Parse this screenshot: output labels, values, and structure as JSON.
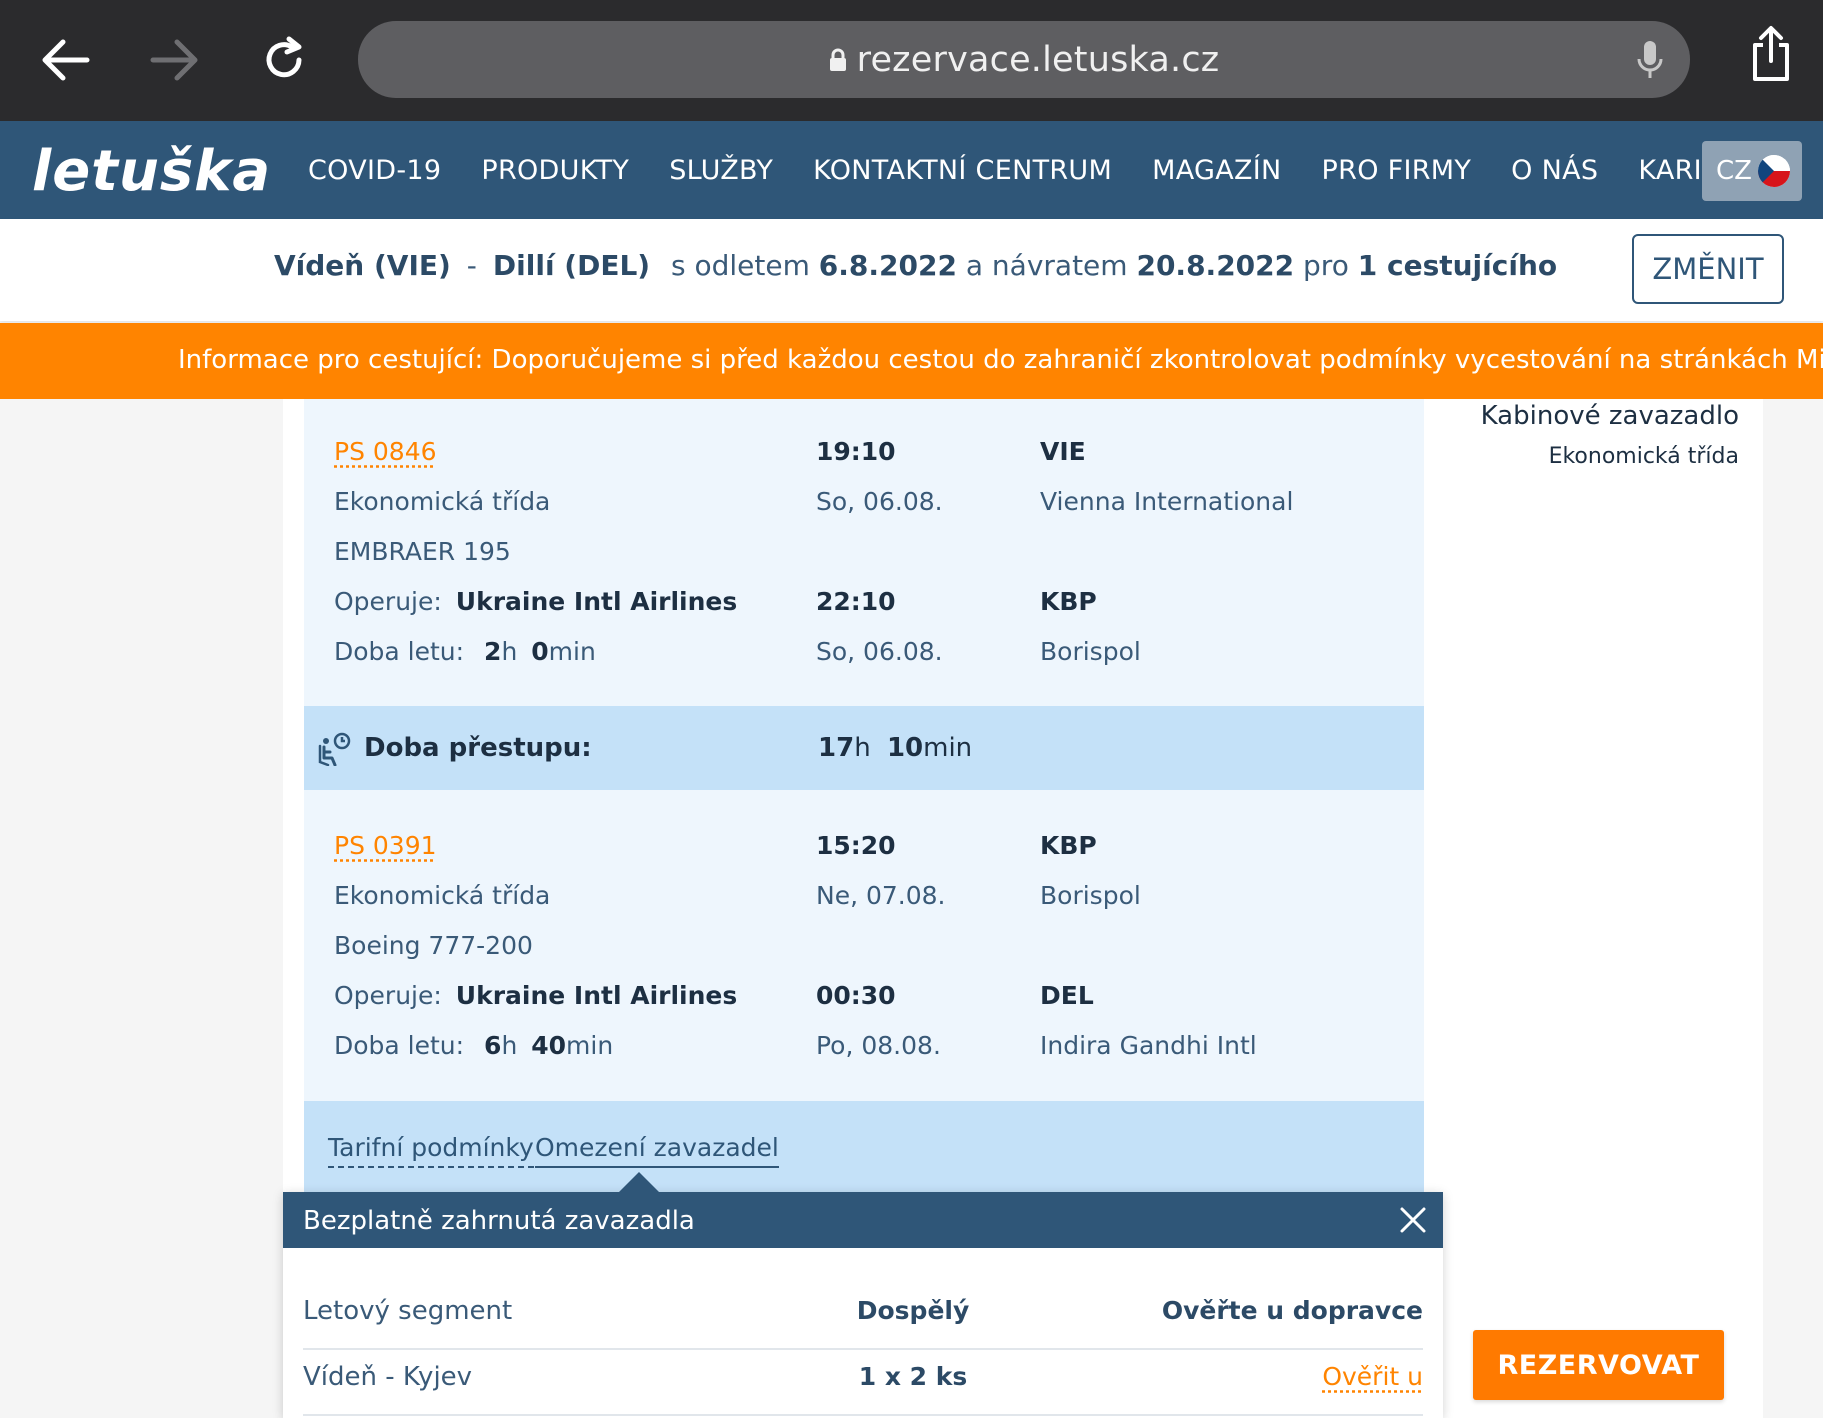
{
  "browser": {
    "url": "rezervace.letuska.cz"
  },
  "site": {
    "logo": "letuška",
    "menu": [
      "COVID-19",
      "PRODUKTY",
      "SLUŽBY",
      "KONTAKTNÍ CENTRUM",
      "MAGAZÍN",
      "PRO FIRMY",
      "O NÁS",
      "KARIÉRA"
    ],
    "language": "CZ"
  },
  "summary": {
    "from": "Vídeň (VIE)",
    "dash": "-",
    "to": "Dillí (DEL)",
    "departure_label": "s odletem",
    "departure_date": "6.8.2022",
    "return_label": "a návratem",
    "return_date": "20.8.2022",
    "for_label": "pro",
    "passengers": "1 cestujícího",
    "change_button": "ZMĚNIT"
  },
  "banner": {
    "text": "Informace pro cestující: Doporučujeme si před každou cestou do zahraničí zkontrolovat podmínky vycestování na stránkách Ministerstva zahra"
  },
  "sidebar": {
    "baggage_title": "Kabinové zavazadlo",
    "baggage_class": "Ekonomická třída"
  },
  "segments": [
    {
      "flight_no": "PS 0846",
      "cabin": "Ekonomická třída",
      "aircraft": "EMBRAER 195",
      "operated_label": "Operuje:",
      "operator": "Ukraine Intl Airlines",
      "duration_label": "Doba letu:",
      "duration_h": "2",
      "duration_m": "0",
      "h_unit": "h",
      "m_unit": "min",
      "dep_time": "19:10",
      "dep_date": "So, 06.08.",
      "dep_code": "VIE",
      "dep_airport": "Vienna International",
      "arr_time": "22:10",
      "arr_date": "So, 06.08.",
      "arr_code": "KBP",
      "arr_airport": "Borispol"
    },
    {
      "flight_no": "PS 0391",
      "cabin": "Ekonomická třída",
      "aircraft": "Boeing 777-200",
      "operated_label": "Operuje:",
      "operator": "Ukraine Intl Airlines",
      "duration_label": "Doba letu:",
      "duration_h": "6",
      "duration_m": "40",
      "h_unit": "h",
      "m_unit": "min",
      "dep_time": "15:20",
      "dep_date": "Ne, 07.08.",
      "dep_code": "KBP",
      "dep_airport": "Borispol",
      "arr_time": "00:30",
      "arr_date": "Po, 08.08.",
      "arr_code": "DEL",
      "arr_airport": "Indira Gandhi Intl"
    }
  ],
  "transfer": {
    "label": "Doba přestupu:",
    "hours": "17",
    "h_unit": "h",
    "minutes": "10",
    "m_unit": "min"
  },
  "tabs": [
    "Tarifní podmínky",
    "Omezení zavazadel"
  ],
  "popup": {
    "title": "Bezplatně zahrnutá zavazadla",
    "headers": [
      "Letový segment",
      "Dospělý",
      "Ověřte u dopravce"
    ],
    "rows": [
      {
        "segment": "Vídeň - Kyjev",
        "adult": "1 x 2 ks",
        "link": "Ověřit u"
      }
    ]
  },
  "book_button": "REZERVOVAT",
  "colors": {
    "nav": "#2f5678",
    "accent": "#ff8400",
    "flight_bg": "#eef6fd",
    "transfer_bg": "#c4e1f8"
  }
}
